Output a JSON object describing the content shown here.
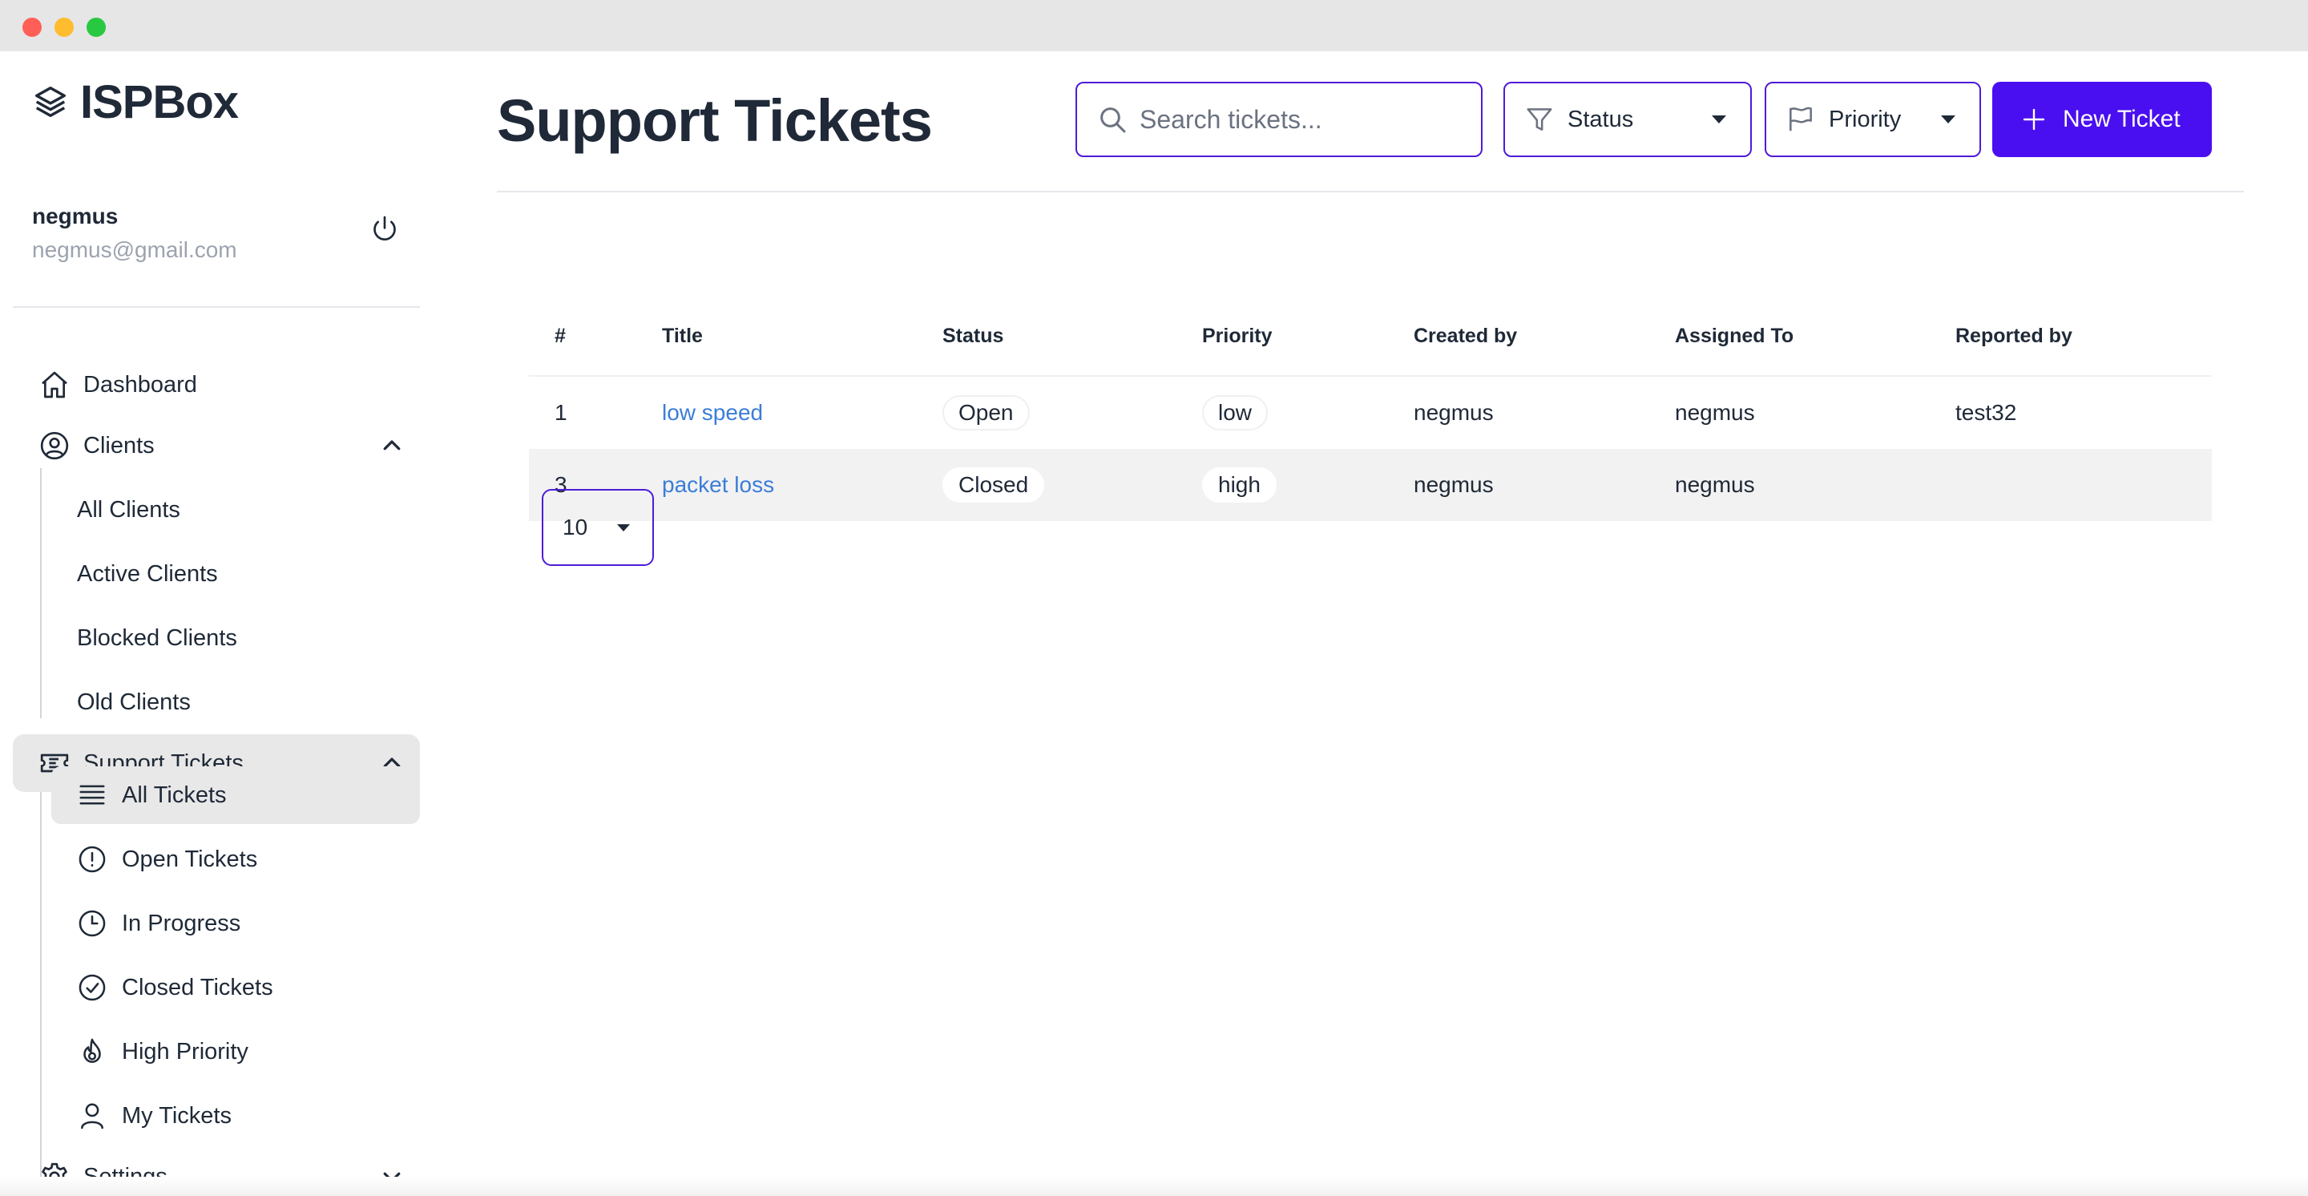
{
  "app": {
    "name": "ISPBox"
  },
  "user": {
    "name": "negmus",
    "email": "negmus@gmail.com"
  },
  "sidebar": {
    "items": [
      {
        "label": "Dashboard",
        "icon": "home-icon"
      },
      {
        "label": "Clients",
        "icon": "user-circle-icon",
        "expanded": true,
        "children": [
          "All Clients",
          "Active Clients",
          "Blocked Clients",
          "Old Clients"
        ]
      },
      {
        "label": "Support Tickets",
        "icon": "ticket-icon",
        "expanded": true,
        "active": true,
        "children": [
          {
            "label": "All Tickets",
            "icon": "list-icon",
            "active": true
          },
          {
            "label": "Open Tickets",
            "icon": "alert-circle-icon"
          },
          {
            "label": "In Progress",
            "icon": "clock-icon"
          },
          {
            "label": "Closed Tickets",
            "icon": "check-circle-icon"
          },
          {
            "label": "High Priority",
            "icon": "flame-icon"
          },
          {
            "label": "My Tickets",
            "icon": "user-icon"
          }
        ]
      },
      {
        "label": "Settings",
        "icon": "gear-icon",
        "expanded": false
      }
    ]
  },
  "header": {
    "title": "Support Tickets",
    "search_placeholder": "Search tickets...",
    "status_filter": "Status",
    "priority_filter": "Priority",
    "new_ticket_label": "New Ticket"
  },
  "table": {
    "columns": [
      "#",
      "Title",
      "Status",
      "Priority",
      "Created by",
      "Assigned To",
      "Reported by"
    ],
    "rows": [
      {
        "id": "1",
        "title": "low speed",
        "status": "Open",
        "priority": "low",
        "created_by": "negmus",
        "assigned_to": "negmus",
        "reported_by": "test32"
      },
      {
        "id": "3",
        "title": "packet loss",
        "status": "Closed",
        "priority": "high",
        "created_by": "negmus",
        "assigned_to": "negmus",
        "reported_by": ""
      }
    ]
  },
  "pagination": {
    "page_size": "10"
  },
  "colors": {
    "accent": "#4a0ff0",
    "link": "#3b7dd8",
    "active_bg": "#e8e8e8"
  }
}
